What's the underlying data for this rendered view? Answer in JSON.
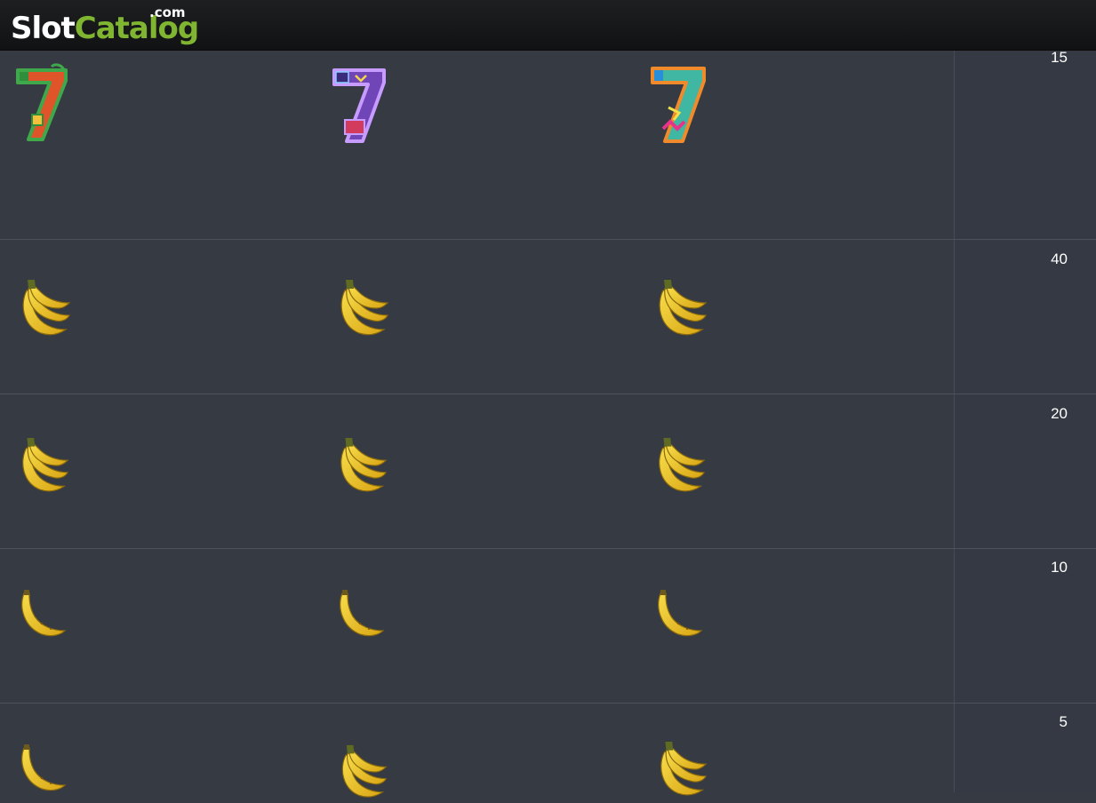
{
  "header": {
    "logo_slot": "Slot",
    "logo_catalog": "Catalog",
    "logo_dotcom": ".com"
  },
  "paytable": {
    "rows": [
      {
        "symbols": [
          "seven-green-icon",
          "seven-purple-icon",
          "seven-orange-icon"
        ],
        "payout": "15"
      },
      {
        "symbols": [
          "banana-bunch-icon",
          "banana-bunch-icon",
          "banana-bunch-icon"
        ],
        "payout": "40"
      },
      {
        "symbols": [
          "banana-bunch-icon",
          "banana-bunch-icon",
          "banana-bunch-icon"
        ],
        "payout": "20"
      },
      {
        "symbols": [
          "banana-icon",
          "banana-icon",
          "banana-icon"
        ],
        "payout": "10"
      },
      {
        "symbols": [
          "banana-icon",
          "banana-bunch-icon",
          "banana-bunch-icon"
        ],
        "payout": "5"
      }
    ]
  },
  "colors": {
    "background": "#363a43",
    "header": "#151617",
    "logo_accent": "#7fb531",
    "seven_green": "#3fa84a",
    "seven_purple": "#8a5bd6",
    "seven_orange": "#f07a2a",
    "banana": "#f2c624"
  }
}
